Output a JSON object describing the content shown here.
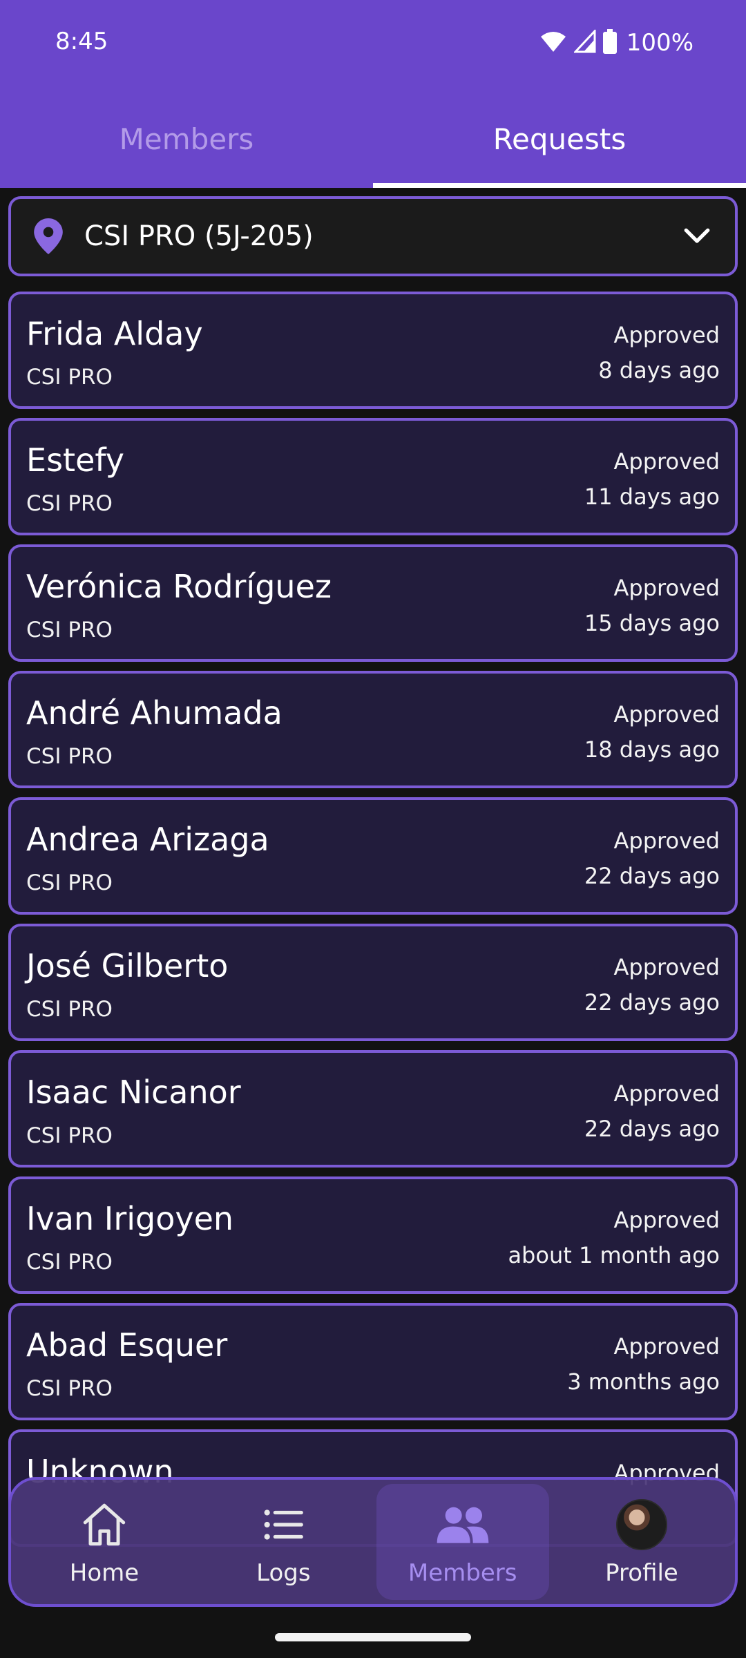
{
  "status_bar": {
    "time": "8:45",
    "battery": "100%"
  },
  "tabs": [
    {
      "label": "Members",
      "active": false
    },
    {
      "label": "Requests",
      "active": true
    }
  ],
  "location_select": {
    "value": "CSI PRO (5J-205)",
    "icon": "location-pin-icon"
  },
  "requests": [
    {
      "name": "Frida Alday",
      "org": "CSI PRO",
      "status": "Approved",
      "time": "8 days ago"
    },
    {
      "name": "Estefy",
      "org": "CSI PRO",
      "status": "Approved",
      "time": "11 days ago"
    },
    {
      "name": "Verónica Rodríguez",
      "org": "CSI PRO",
      "status": "Approved",
      "time": "15 days ago"
    },
    {
      "name": "André Ahumada",
      "org": "CSI PRO",
      "status": "Approved",
      "time": "18 days ago"
    },
    {
      "name": "Andrea Arizaga",
      "org": "CSI PRO",
      "status": "Approved",
      "time": "22 days ago"
    },
    {
      "name": "José Gilberto",
      "org": "CSI PRO",
      "status": "Approved",
      "time": "22 days ago"
    },
    {
      "name": "Isaac Nicanor",
      "org": "CSI PRO",
      "status": "Approved",
      "time": "22 days ago"
    },
    {
      "name": "Ivan Irigoyen",
      "org": "CSI PRO",
      "status": "Approved",
      "time": "about 1 month ago"
    },
    {
      "name": "Abad Esquer",
      "org": "CSI PRO",
      "status": "Approved",
      "time": "3 months ago"
    },
    {
      "name": "Unknown",
      "org": "",
      "status": "Approved",
      "time": ""
    }
  ],
  "bottom_nav": [
    {
      "label": "Home",
      "icon": "home-icon",
      "active": false
    },
    {
      "label": "Logs",
      "icon": "list-icon",
      "active": false
    },
    {
      "label": "Members",
      "icon": "members-icon",
      "active": true
    },
    {
      "label": "Profile",
      "icon": "avatar",
      "active": false
    }
  ],
  "colors": {
    "header": "#6a46cb",
    "accent": "#7c5bd6",
    "card_bg": "#221c3c",
    "active_nav_label": "#a68ef0"
  }
}
